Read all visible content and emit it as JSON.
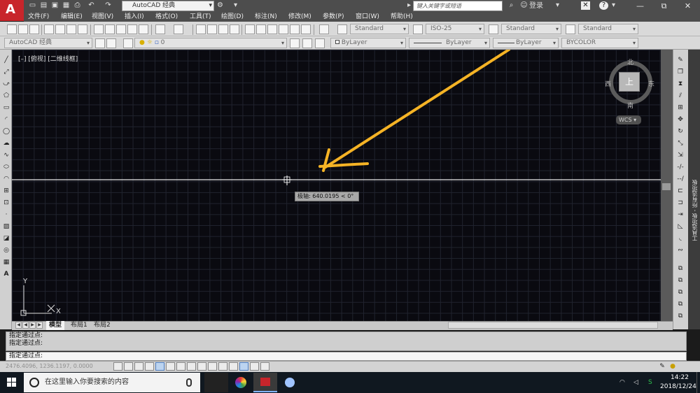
{
  "titlebar": {
    "workspace": "AutoCAD 经典",
    "search_placeholder": "键入关键字或短语",
    "login": "登录",
    "help_mark": "?",
    "minimize": "—",
    "restore": "⧉",
    "close": "✕"
  },
  "menu": [
    "文件(F)",
    "编辑(E)",
    "视图(V)",
    "插入(I)",
    "格式(O)",
    "工具(T)",
    "绘图(D)",
    "标注(N)",
    "修改(M)",
    "参数(P)",
    "窗口(W)",
    "帮助(H)"
  ],
  "toolbar1": {
    "text_style": "Standard",
    "dim_style": "ISO-25",
    "table_style": "Standard",
    "mleader_style": "Standard"
  },
  "toolbar2": {
    "workspace": "AutoCAD 经典",
    "layer": "0",
    "color": "ByLayer",
    "linetype": "ByLayer",
    "lineweight": "ByLayer",
    "plotstyle": "BYCOLOR"
  },
  "viewport": {
    "label": "[–] [俯视] [二维线框]",
    "cube_top": "上",
    "north": "北",
    "south": "南",
    "east": "东",
    "west": "西",
    "ucs": "WCS",
    "tooltip": "极轴: 640.0195 < 0°",
    "axis_x": "X",
    "axis_y": "Y"
  },
  "tabs": {
    "model": "模型",
    "layout1": "布局1",
    "layout2": "布局2"
  },
  "command": {
    "history": [
      "指定通过点:",
      "指定通过点:"
    ],
    "prompt": "指定通过点:"
  },
  "status": {
    "coords": "2476.4096, 1236.1197, 0.0000"
  },
  "side_panel": {
    "tool_palettes": "工具选项板 - 所有选项板"
  },
  "taskbar": {
    "search": "在这里输入你要搜索的内容",
    "time": "14:22",
    "date": "2018/12/24"
  },
  "colors": {
    "annotation_arrow": "#f5b325",
    "crosshair": "#e8e8e8",
    "canvas": "#0a0a10"
  }
}
